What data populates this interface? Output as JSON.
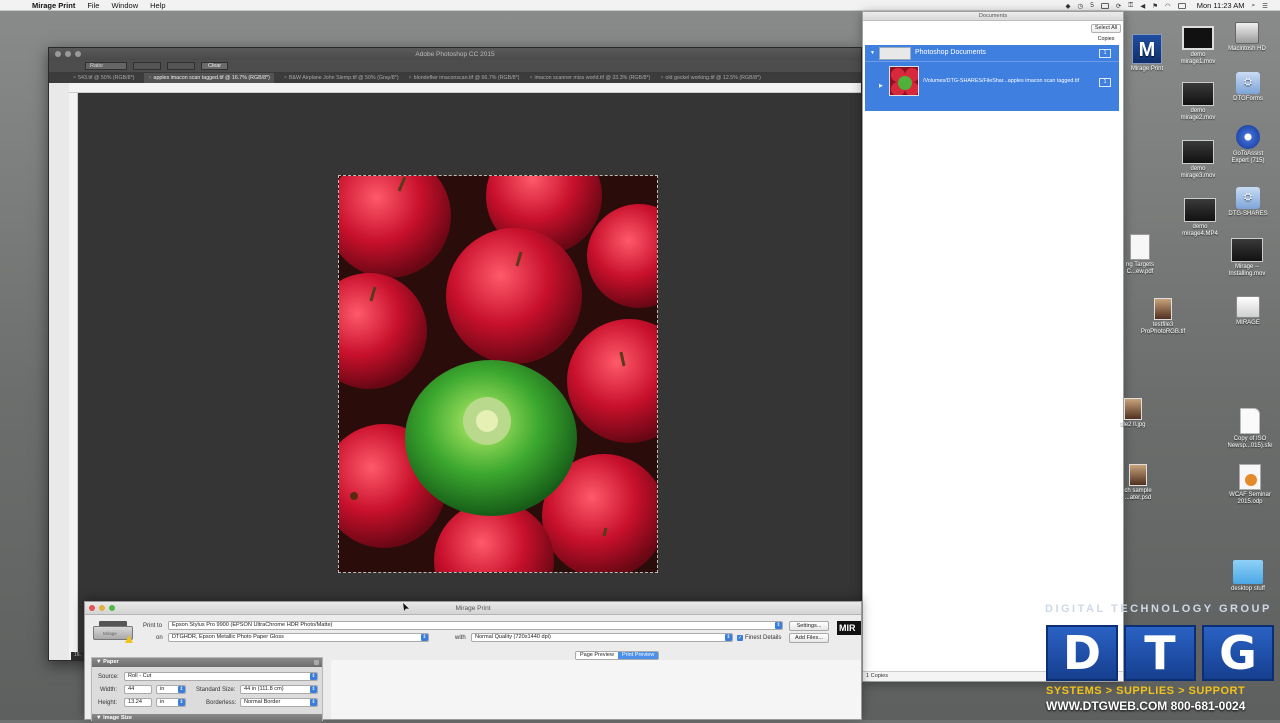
{
  "menubar": {
    "app_name": "Mirage Print",
    "items": [
      "File",
      "Window",
      "Help"
    ],
    "status_items": [
      "5"
    ],
    "clock": "Mon 11:23 AM"
  },
  "photoshop": {
    "title": "Adobe Photoshop CC 2015",
    "options": {
      "style_value": "Ratio",
      "clear_label": "Clear"
    },
    "tabs": [
      {
        "label": "543.tif @ 50% (RGB/8*)",
        "active": false
      },
      {
        "label": "apples imacon scan tagged.tif @ 16.7% (RGB/8*)",
        "active": true
      },
      {
        "label": "B&W Airplane John Slemp.tif @ 50% (Gray/8*)",
        "active": false
      },
      {
        "label": "blondeflwr imaconscan.tif @ 66.7% (RGB/8*)",
        "active": false
      },
      {
        "label": "imacon scanner miss world.tif @ 33.3% (RGB/8*)",
        "active": false
      },
      {
        "label": "old gockel working.tif @ 12.5% (RGB/8*)",
        "active": false
      }
    ],
    "status": "16."
  },
  "mirage": {
    "title": "Mirage Print",
    "print_to_label": "Print to",
    "printer": "Epson Stylus Pro 9900 (EPSON UltraChrome HDR Photo/Matte)",
    "on_label": "on",
    "paper": "DTGHDR, Epson Metallic Photo Paper Gloss",
    "with_label": "with",
    "quality": "Normal Quality (720x1440 dpi)",
    "finest_details": "Finest Details",
    "settings_button": "Settings...",
    "add_files_button": "Add Files...",
    "logo": "MIR",
    "printer_tag": "Mirage",
    "tabs": [
      "Page Preview",
      "Print Preview"
    ],
    "paper_section": {
      "title": "Paper",
      "source_label": "Source:",
      "source_value": "Roll - Cut",
      "width_label": "Width:",
      "width_value": "44",
      "width_unit": "in",
      "height_label": "Height:",
      "height_value": "13.24",
      "height_unit": "in",
      "standard_size_label": "Standard Size:",
      "standard_size_value": "44 in (111.8 cm)",
      "borderless_label": "Borderless:",
      "borderless_value": "Normal Border"
    },
    "image_size_section": {
      "title": "Image Size"
    }
  },
  "documents": {
    "title": "Documents",
    "select_all": "Select All",
    "copies_label": "Copies",
    "group_name": "Photoshop Documents",
    "group_count": "1",
    "item_path": "/Volumes/DTG-SHARES/FileShar...apples imacon scan tagged.tif",
    "item_count": "1",
    "footer": "1 Copies"
  },
  "desktop_icons": [
    {
      "label": "Mirage Print",
      "icon": "mirage-app-icon"
    },
    {
      "label": "Macintosh HD",
      "icon": "hard-drive-icon"
    },
    {
      "label": "demo mirage1.mov",
      "icon": "movie-file-icon"
    },
    {
      "label": "DTGForms",
      "icon": "network-share-icon"
    },
    {
      "label": "demo mirage2.mov",
      "icon": "movie-file-icon"
    },
    {
      "label": "GoToAssist Expert (715)",
      "icon": "gear-app-icon"
    },
    {
      "label": "demo mirage3.mov",
      "icon": "movie-file-icon"
    },
    {
      "label": "DTG-SHARES",
      "icon": "network-share-icon"
    },
    {
      "label": "demo mirage4.MP4",
      "icon": "movie-file-icon"
    },
    {
      "label": "Mirage -- Installing.mov",
      "icon": "movie-file-icon"
    },
    {
      "label": "ng Targets C...ew.pdf",
      "icon": "pdf-file-icon"
    },
    {
      "label": "MIRAGE",
      "icon": "external-disk-icon"
    },
    {
      "label": "testfile3 ProPhotoRGB.tif",
      "icon": "image-file-icon"
    },
    {
      "label": "file2 ll.jpg",
      "icon": "image-file-icon"
    },
    {
      "label": "Copy of ISO Newsp...015).sfe",
      "icon": "generic-file-icon"
    },
    {
      "label": "ch sample ...ater.psd",
      "icon": "image-file-icon"
    },
    {
      "label": "WCAF Seminar 2015.odp",
      "icon": "presentation-file-icon"
    },
    {
      "label": "desktop stuff",
      "icon": "folder-icon"
    }
  ],
  "watermark": {
    "tagline": "DIGITAL TECHNOLOGY GROUP",
    "letters": [
      "D",
      "T",
      "G"
    ],
    "slogan": "SYSTEMS > SUPPLIES > SUPPORT",
    "web": "WWW.DTGWEB.COM 800-681-0024"
  }
}
